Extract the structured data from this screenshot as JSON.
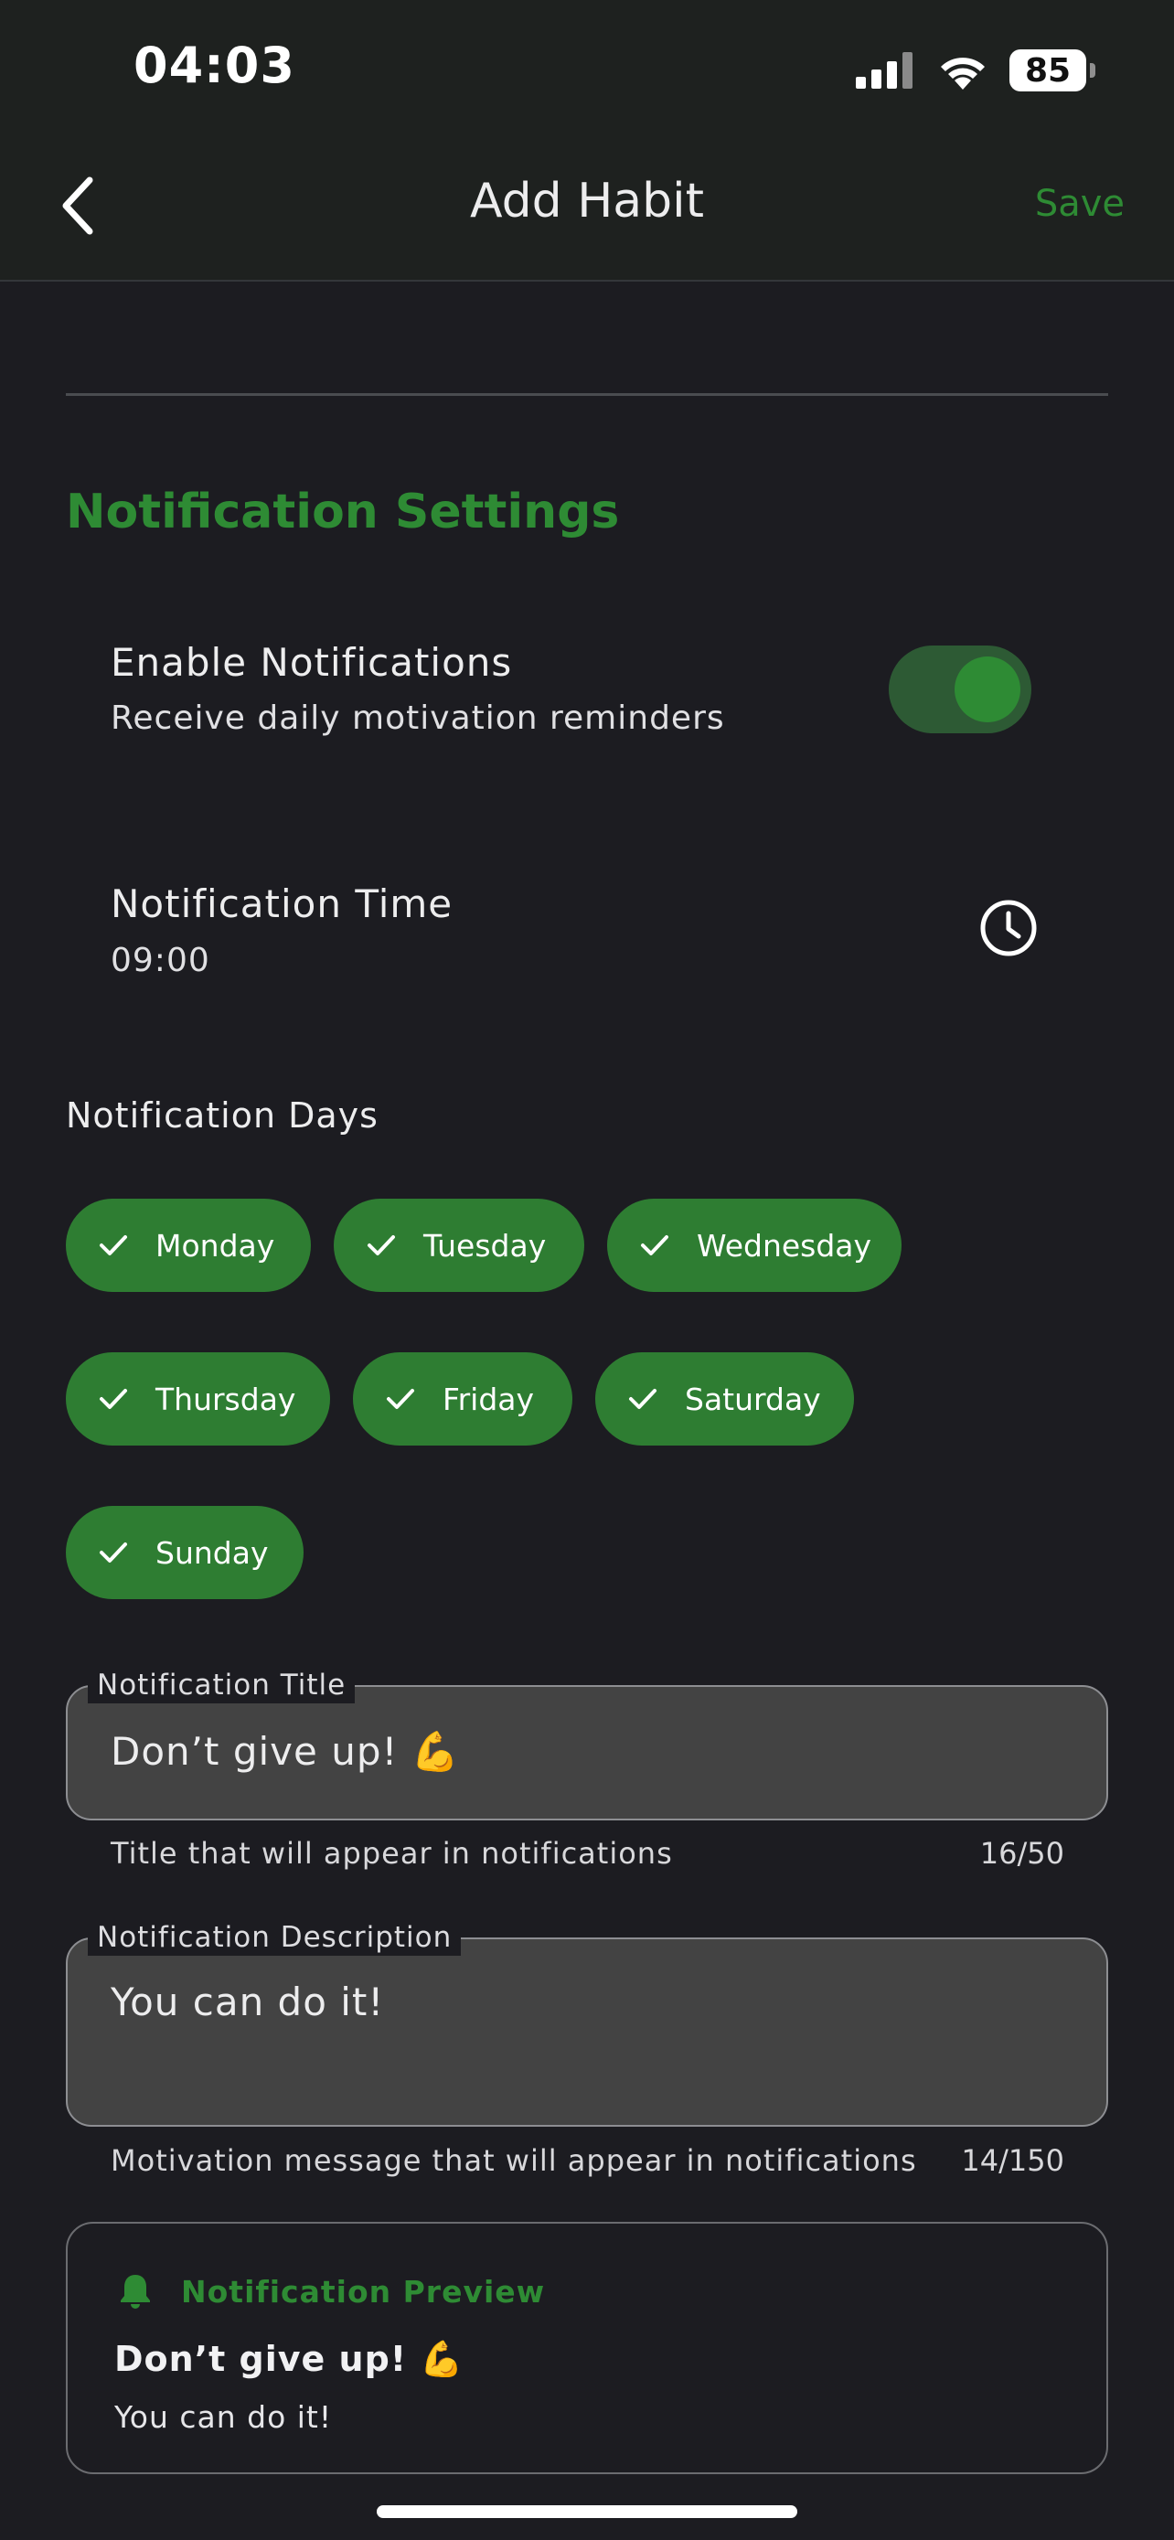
{
  "status_bar": {
    "time": "04:03",
    "battery": "85"
  },
  "header": {
    "title": "Add Habit",
    "save_label": "Save"
  },
  "section": {
    "title": "Notification Settings"
  },
  "enable_notifications": {
    "title": "Enable Notifications",
    "subtitle": "Receive daily motivation reminders",
    "on": true
  },
  "notification_time": {
    "title": "Notification Time",
    "value": "09:00"
  },
  "days": {
    "label": "Notification Days",
    "items": [
      "Monday",
      "Tuesday",
      "Wednesday",
      "Thursday",
      "Friday",
      "Saturday",
      "Sunday"
    ]
  },
  "title_field": {
    "label": "Notification Title",
    "value": "Don’t give up! 💪",
    "helper": "Title that will appear in notifications",
    "counter": "16/50"
  },
  "description_field": {
    "label": "Notification Description",
    "value": "You can do it!",
    "helper": "Motivation message that will appear in notifications",
    "counter": "14/150"
  },
  "preview": {
    "header": "Notification Preview",
    "title": "Don’t give up! 💪",
    "body": "You can do it!"
  },
  "colors": {
    "accent": "#2e8b34",
    "chip": "#2e7d32",
    "background": "#1c1c21"
  },
  "icons": {
    "back": "chevron-left-icon",
    "clock": "clock-icon",
    "check": "check-icon",
    "bell": "bell-icon"
  }
}
